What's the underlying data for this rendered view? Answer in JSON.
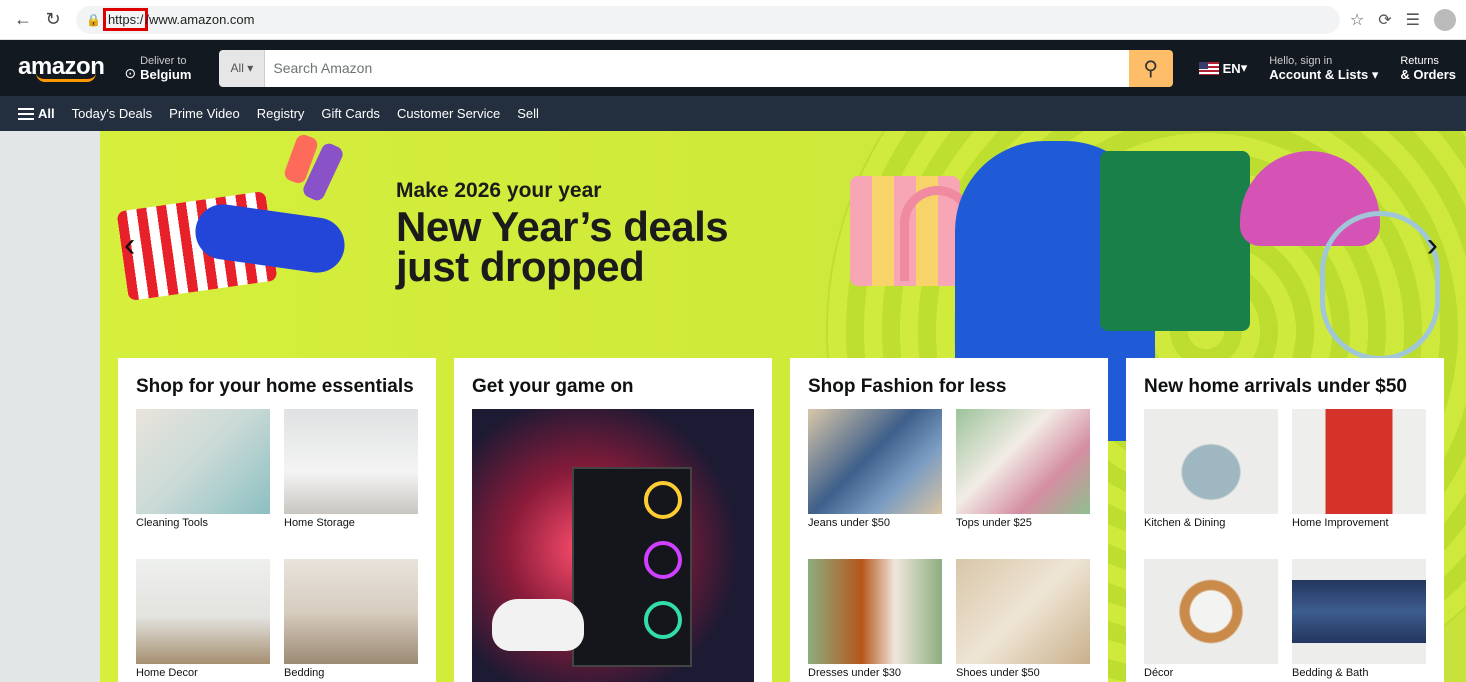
{
  "browser": {
    "url_scheme": "https:/",
    "url_rest": "/www.amazon.com"
  },
  "header": {
    "logo": "amazon",
    "deliver_label": "Deliver to",
    "deliver_location": "Belgium",
    "search_category": "All",
    "search_placeholder": "Search Amazon",
    "language": "EN",
    "account_greeting": "Hello, sign in",
    "account_label": "Account & Lists",
    "returns_label": "Returns",
    "orders_label": "& Orders"
  },
  "subnav": {
    "all": "All",
    "items": [
      "Today's Deals",
      "Prime Video",
      "Registry",
      "Gift Cards",
      "Customer Service",
      "Sell"
    ]
  },
  "hero": {
    "kicker": "Make 2026 your year",
    "headline_line1": "New Year’s deals",
    "headline_line2": "just dropped"
  },
  "cards": [
    {
      "title": "Shop for your home essentials",
      "tiles": [
        "Cleaning Tools",
        "Home Storage",
        "Home Decor",
        "Bedding"
      ]
    },
    {
      "title": "Get your game on"
    },
    {
      "title": "Shop Fashion for less",
      "tiles": [
        "Jeans under $50",
        "Tops under $25",
        "Dresses under $30",
        "Shoes under $50"
      ]
    },
    {
      "title": "New home arrivals under $50",
      "tiles": [
        "Kitchen & Dining",
        "Home Improvement",
        "Décor",
        "Bedding & Bath"
      ]
    }
  ],
  "colors": {
    "header_bg": "#131921",
    "subnav_bg": "#232f3e",
    "search_btn": "#febd69",
    "hero_bg": "#d6ef3d",
    "accent": "#ff9900"
  }
}
